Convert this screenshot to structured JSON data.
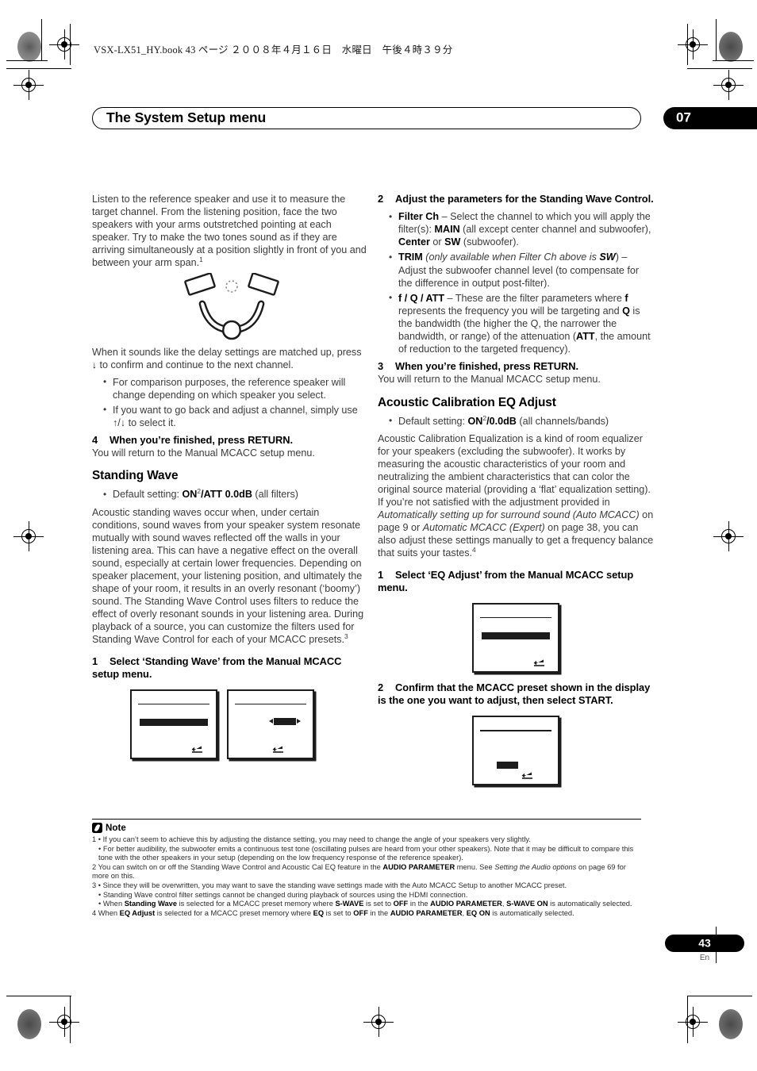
{
  "print_header": "VSX-LX51_HY.book   43 ページ   ２００８年４月１６日　水曜日　午後４時３９分",
  "header": {
    "title": "The System Setup menu",
    "chapter": "07"
  },
  "left_column": {
    "intro_paragraph": "Listen to the reference speaker and use it to measure the target channel. From the listening position, face the two speakers with your arms outstretched pointing at each speaker. Try to make the two tones sound as if they are arriving simultaneously at a position slightly in front of you and between your arm span.",
    "intro_footnote_ref": "1",
    "illustration_name": "two-speakers-listener-arms-outstretched",
    "after_illus_paragraph_a": "When it sounds like the delay settings are matched up, press",
    "after_illus_arrow": "↓",
    "after_illus_paragraph_b": "to confirm and continue to the next channel.",
    "bullets": [
      "For comparison purposes, the reference speaker will change depending on which speaker you select.",
      "If you want to go back and adjust a channel, simply use ↑/↓ to select it."
    ],
    "step4_num": "4",
    "step4_text": "When you’re finished, press RETURN.",
    "step4_body": "You will return to the Manual MCACC setup menu.",
    "standing_wave_heading": "Standing Wave",
    "default_setting_label": "Default setting:",
    "default_setting_on": "ON",
    "default_setting_on_ref": "2",
    "default_setting_att": "/ATT 0.0dB",
    "default_setting_suffix": "(all filters)",
    "standing_wave_body": "Acoustic standing waves occur when, under certain conditions, sound waves from your speaker system resonate mutually with sound waves reflected off the walls in your listening area. This can have a negative effect on the overall sound, especially at certain lower frequencies. Depending on speaker placement, your listening position, and ultimately the shape of your room, it results in an overly resonant (‘boomy’) sound. The Standing Wave Control uses filters to reduce the effect of overly resonant sounds in your listening area. During playback of a source, you can customize the filters used for Standing Wave Control for each of your MCACC presets.",
    "standing_wave_body_ref": "3",
    "step1_num": "1",
    "step1_text": "Select ‘Standing Wave’ from the Manual MCACC setup menu.",
    "screens": [
      {
        "name": "osd-standing-wave-menu",
        "bar": "wide"
      },
      {
        "name": "osd-standing-wave-filter",
        "bar": "value"
      }
    ]
  },
  "right_column": {
    "step2_num": "2",
    "step2_text": "Adjust the parameters for the Standing Wave Control.",
    "bullets": [
      {
        "term": "Filter Ch",
        "text_a": " – Select the channel to which you will apply the filter(s): ",
        "b1": "MAIN",
        "text_b": " (all except center channel and subwoofer), ",
        "b2": "Center",
        "text_c": " or ",
        "b3": "SW",
        "text_d": " (subwoofer)."
      },
      {
        "term": "TRIM",
        "text_a": " (only available when Filter Ch above is ",
        "b1": "SW",
        "text_b": ") – Adjust the subwoofer channel level (to compensate for the difference in output post-filter)."
      },
      {
        "term": "f / Q / ATT",
        "text_a": " – These are the filter parameters where ",
        "b1": "f",
        "text_b": " represents the frequency you will be targeting and ",
        "b2": "Q",
        "text_c": " is the bandwidth (the higher the Q, the narrower the bandwidth, or range) of the attenuation (",
        "b3": "ATT",
        "text_d": ", the amount of reduction to the targeted frequency)."
      }
    ],
    "step3_num": "3",
    "step3_text": "When you’re finished, press RETURN.",
    "step3_body": "You will return to the Manual MCACC setup menu.",
    "eq_heading": "Acoustic Calibration EQ Adjust",
    "default_setting_label": "Default setting:",
    "default_setting_on": "ON",
    "default_setting_on_ref": "2",
    "default_setting_db": "/0.0dB",
    "default_setting_suffix": "(all channels/bands)",
    "eq_body_a": "Acoustic Calibration Equalization is a kind of room equalizer for your speakers (excluding the subwoofer). It works by measuring the acoustic characteristics of your room and neutralizing the ambient characteristics that can color the original source material (providing a ‘flat’ equalization setting). If you’re not satisfied with the adjustment provided in ",
    "eq_body_i1": "Automatically setting up for surround sound (Auto MCACC)",
    "eq_body_b": " on page 9 or ",
    "eq_body_i2": "Automatic MCACC (Expert)",
    "eq_body_c": " on page 38, you can also adjust these settings manually to get a frequency balance that suits your tastes.",
    "eq_body_ref": "4",
    "step1_num": "1",
    "step1_text": "Select ‘EQ Adjust’ from the Manual MCACC setup menu.",
    "screen1_name": "osd-eq-adjust-menu",
    "step2b_num": "2",
    "step2b_text": "Confirm that the MCACC preset shown in the display is the one you want to adjust, then select START.",
    "screen2_name": "osd-mcacc-preset-confirm"
  },
  "note": {
    "label": "Note",
    "lines": [
      {
        "kind": "num",
        "num": "1",
        "bullet": true,
        "text": "If you can’t seem to achieve this by adjusting the distance setting, you may need to change the angle of your speakers very slightly."
      },
      {
        "kind": "sub",
        "text": "For better audibility, the subwoofer emits a continuous test tone (oscillating pulses are heard from your other speakers). Note that it may be difficult to compare this tone with the other speakers in your setup (depending on the low frequency response of the reference speaker)."
      },
      {
        "kind": "num",
        "num": "2",
        "bullet": false,
        "text": "You can switch on or off the Standing Wave Control and Acoustic Cal EQ feature in the AUDIO PARAMETER menu. See Setting the Audio options on page 69 for more on this."
      },
      {
        "kind": "num",
        "num": "3",
        "bullet": true,
        "text": "Since they will be overwritten, you may want to save the standing wave settings made with the Auto MCACC Setup to another MCACC preset."
      },
      {
        "kind": "sub",
        "text": "Standing Wave control filter settings cannot be changed during playback of sources using the HDMI connection."
      },
      {
        "kind": "sub",
        "text": "When Standing Wave is selected for a MCACC preset memory where S-WAVE is set to OFF in the AUDIO PARAMETER, S-WAVE ON is automatically selected."
      },
      {
        "kind": "num",
        "num": "4",
        "bullet": false,
        "text": "When EQ Adjust is selected for a MCACC preset memory where EQ is set to OFF in the AUDIO PARAMETER, EQ ON is automatically selected."
      }
    ]
  },
  "footer": {
    "page_number": "43",
    "language": "En"
  },
  "colors": {
    "ink": "#000000",
    "body_text": "#3b3b3b",
    "screen_border": "#1c1c1c"
  }
}
